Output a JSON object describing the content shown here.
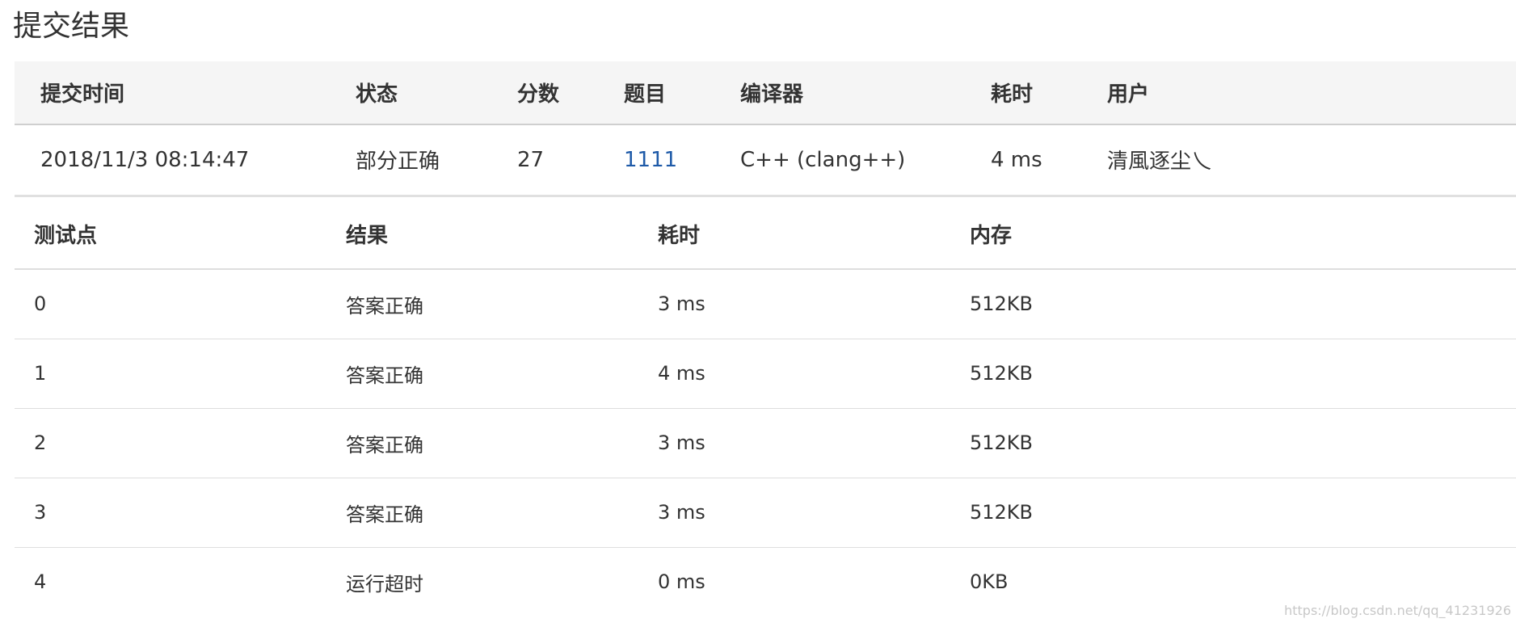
{
  "page": {
    "title": "提交结果"
  },
  "summary": {
    "headers": [
      "提交时间",
      "状态",
      "分数",
      "题目",
      "编译器",
      "耗时",
      "用户"
    ],
    "row": {
      "time": "2018/11/3 08:14:47",
      "status": "部分正确",
      "score": "27",
      "problem": "1111",
      "compiler": "C++ (clang++)",
      "duration": "4 ms",
      "user": "清風逐尘乀"
    }
  },
  "cases": {
    "headers": [
      "测试点",
      "结果",
      "耗时",
      "内存"
    ],
    "rows": [
      {
        "id": "0",
        "result": "答案正确",
        "time": "3 ms",
        "memory": "512KB"
      },
      {
        "id": "1",
        "result": "答案正确",
        "time": "4 ms",
        "memory": "512KB"
      },
      {
        "id": "2",
        "result": "答案正确",
        "time": "3 ms",
        "memory": "512KB"
      },
      {
        "id": "3",
        "result": "答案正确",
        "time": "3 ms",
        "memory": "512KB"
      },
      {
        "id": "4",
        "result": "运行超时",
        "time": "0 ms",
        "memory": "0KB"
      }
    ]
  },
  "colors": {
    "accepted": "#e53935",
    "partial": "#43a047",
    "timeout": "#43a047",
    "link": "#1e5aa8"
  },
  "watermark": "https://blog.csdn.net/qq_41231926"
}
